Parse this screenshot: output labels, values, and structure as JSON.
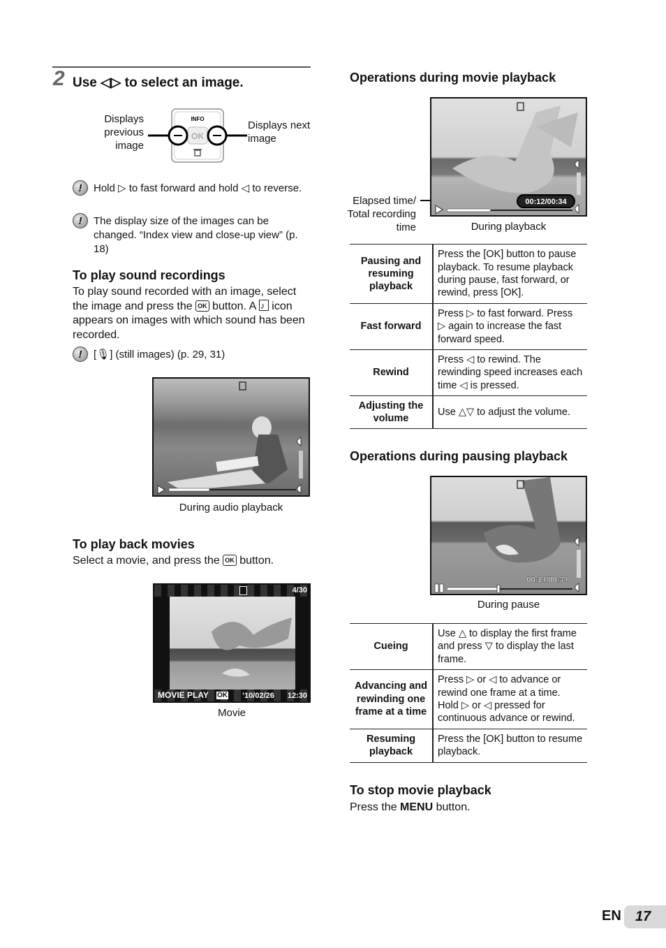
{
  "step": {
    "number": "2",
    "title": "Use ◁▷ to select an image.",
    "dial": {
      "info_label": "INFO",
      "ok_label": "OK",
      "left_label": "Displays previous image",
      "right_label": "Displays next image"
    },
    "notes": [
      "Hold ▷ to fast forward and hold ◁ to reverse.",
      "The display size of the images can be changed. “Index view and close-up view” (p. 18)"
    ]
  },
  "sound": {
    "heading": "To play sound recordings",
    "body_part1": "To play sound recorded with an image, select the image and press the",
    "ok": "OK",
    "body_part2": "button. A",
    "body_part3": "icon appears on images with which sound has been recorded.",
    "note": "[🎙] (still images) (p. 29, 31)",
    "screen_caption": "During audio playback",
    "progress": 0.32
  },
  "movies": {
    "heading": "To play back movies",
    "body_part1": "Select a movie, and press the",
    "ok": "OK",
    "body_part2": "button.",
    "screen": {
      "counter": "4/30",
      "movie_play": "MOVIE PLAY",
      "ok": "OK",
      "date": "’10/02/26",
      "time": "12:30"
    },
    "screen_caption": "Movie"
  },
  "movie_playback": {
    "heading": "Operations during movie playback",
    "elapsed_label": "Elapsed time/ Total recording time",
    "time_readout": "00:12/00:34",
    "progress": 0.35,
    "screen_caption": "During playback",
    "rows": [
      {
        "key": "Pausing and resuming playback",
        "value": "Press the [OK] button to pause playback. To resume playback during pause, fast forward, or rewind, press [OK]."
      },
      {
        "key": "Fast forward",
        "value": "Press ▷ to fast forward. Press ▷ again to increase the fast forward speed."
      },
      {
        "key": "Rewind",
        "value": "Press ◁ to rewind. The rewinding speed increases each time ◁ is pressed."
      },
      {
        "key": "Adjusting the volume",
        "value": "Use △▽ to adjust the volume."
      }
    ]
  },
  "pause_playback": {
    "heading": "Operations during pausing playback",
    "time_readout": "00:14/00:34",
    "progress": 0.41,
    "screen_caption": "During pause",
    "rows": [
      {
        "key": "Cueing",
        "value": "Use △ to display the first frame and press ▽ to display the last frame."
      },
      {
        "key": "Advancing and rewinding one frame at a time",
        "value": "Press ▷ or ◁ to advance or rewind one frame at a time. Hold ▷ or ◁ pressed for continuous advance or rewind."
      },
      {
        "key": "Resuming playback",
        "value": "Press the [OK] button to resume playback."
      }
    ]
  },
  "stop": {
    "heading": "To stop movie playback",
    "body_part1": "Press the",
    "menu": "MENU",
    "body_part2": "button."
  },
  "footer": {
    "lang": "EN",
    "page": "17"
  }
}
